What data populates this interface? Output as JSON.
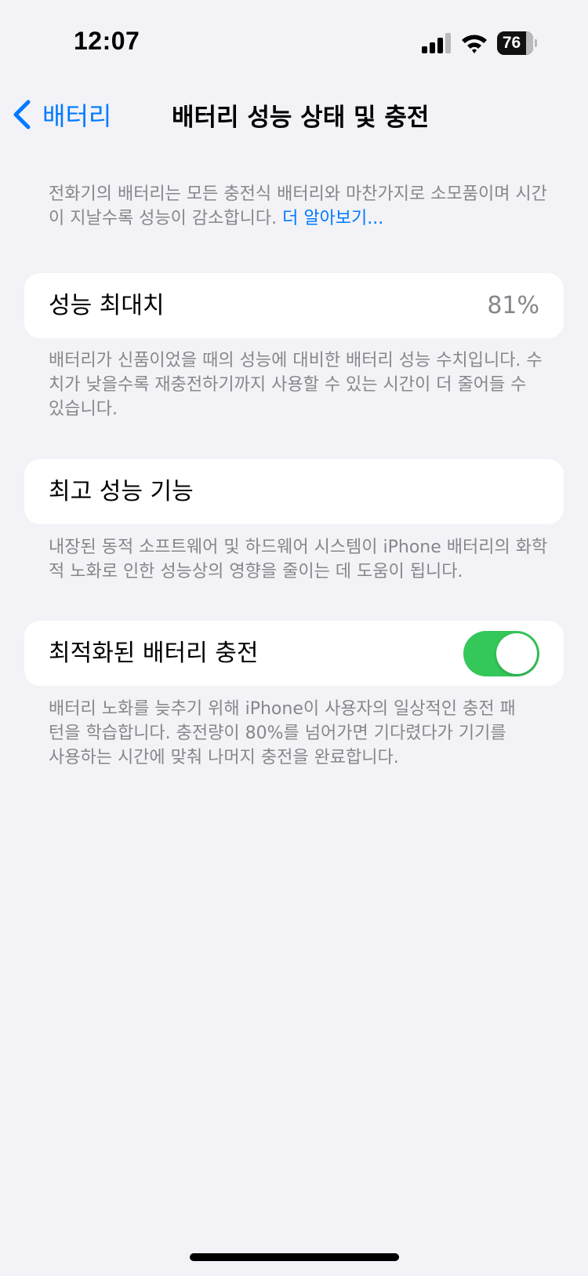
{
  "status_bar": {
    "time": "12:07",
    "battery_level": "76",
    "battery_fraction": 0.76,
    "icons": [
      "cellular-signal-icon",
      "wifi-icon",
      "battery-icon"
    ]
  },
  "nav": {
    "back_label": "배터리",
    "title": "배터리 성능 상태 및 충전"
  },
  "intro": {
    "text": "전화기의 배터리는 모든 충전식 배터리와 마찬가지로 소모품이며 시간이 지날수록 성능이 감소합니다. ",
    "link": "더 알아보기..."
  },
  "max_capacity": {
    "label": "성능 최대치",
    "value": "81%",
    "footnote": "배터리가 신품이었을 때의 성능에 대비한 배터리 성능 수치입니다. 수치가 낮을수록 재충전하기까지 사용할 수 있는 시간이 더 줄어들 수 있습니다."
  },
  "peak_performance": {
    "label": "최고 성능 기능",
    "footnote": "내장된 동적 소프트웨어 및 하드웨어 시스템이 iPhone 배터리의 화학적 노화로 인한 성능상의 영향을 줄이는 데 도움이 됩니다."
  },
  "optimized_charging": {
    "label": "최적화된 배터리 충전",
    "enabled": true,
    "footnote": "배터리 노화를 늦추기 위해 iPhone이 사용자의 일상적인 충전 패턴을 학습합니다. 충전량이 80%를 넘어가면 기다렸다가 기기를 사용하는 시간에 맞춰 나머지 충전을 완료합니다."
  },
  "colors": {
    "accent": "#007aff",
    "toggle_on": "#34c759",
    "background": "#f2f2f7",
    "secondary_text": "#86868b"
  }
}
